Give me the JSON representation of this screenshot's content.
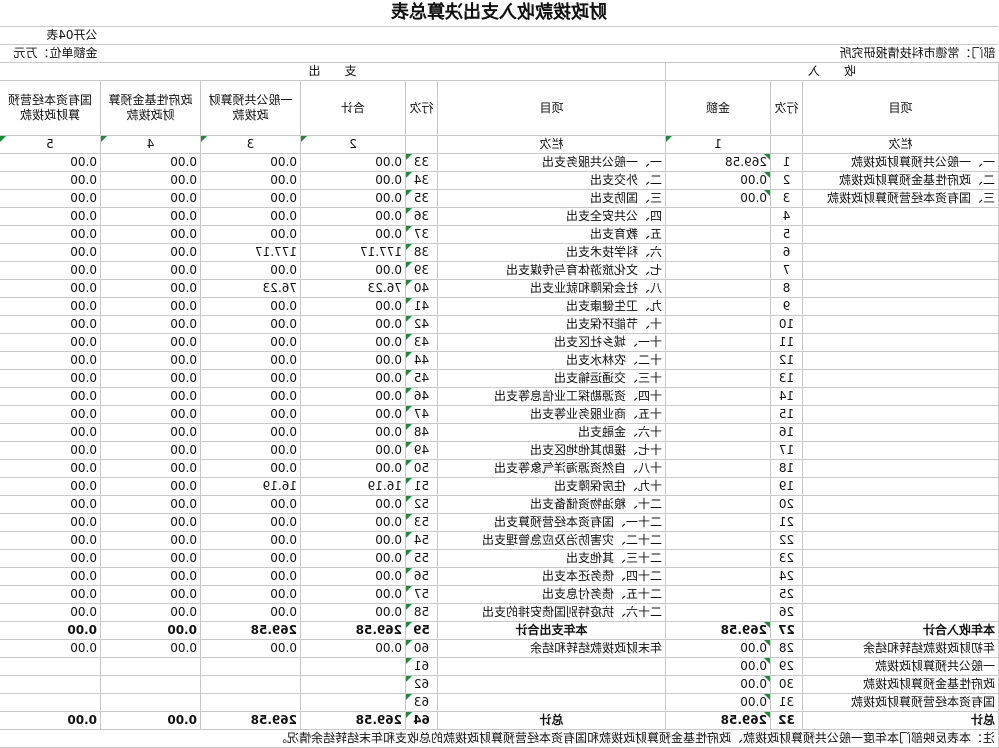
{
  "title": "财政拨款收入支出决算总表",
  "form_code": "公开04表",
  "unit": "金额单位：万元",
  "department": "部门：常德市科技情报研究所",
  "section_income": "收　　入",
  "section_expense": "支　　出",
  "headers": {
    "item": "项目",
    "line": "行次",
    "amount": "金额",
    "item2": "项目",
    "line2": "行次",
    "total": "合计",
    "general": "一般公共预算财政拨款",
    "fund": "政府性基金预算财政拨款",
    "state": "国有资本经营预算财政拨款"
  },
  "col_index": {
    "a": "栏次",
    "b": "1",
    "c": "栏次",
    "d": "2",
    "e": "3",
    "f": "4",
    "g": "5"
  },
  "rows": [
    {
      "income_item": "一、一般公共预算财政拨款",
      "line": "1",
      "amount": "269.58",
      "expense_item": "一、一般公共服务支出",
      "line2": "33",
      "total": "0.00",
      "general": "0.00",
      "fund": "0.00",
      "state": "0.00"
    },
    {
      "income_item": "二、政府性基金预算财政拨款",
      "line": "2",
      "amount": "0.00",
      "expense_item": "二、外交支出",
      "line2": "34",
      "total": "0.00",
      "general": "0.00",
      "fund": "0.00",
      "state": "0.00"
    },
    {
      "income_item": "三、国有资本经营预算财政拨款",
      "line": "3",
      "amount": "0.00",
      "expense_item": "三、国防支出",
      "line2": "35",
      "total": "0.00",
      "general": "0.00",
      "fund": "0.00",
      "state": "0.00"
    },
    {
      "income_item": "",
      "line": "4",
      "amount": "",
      "expense_item": "四、公共安全支出",
      "line2": "36",
      "total": "0.00",
      "general": "0.00",
      "fund": "0.00",
      "state": "0.00"
    },
    {
      "income_item": "",
      "line": "5",
      "amount": "",
      "expense_item": "五、教育支出",
      "line2": "37",
      "total": "0.00",
      "general": "0.00",
      "fund": "0.00",
      "state": "0.00"
    },
    {
      "income_item": "",
      "line": "6",
      "amount": "",
      "expense_item": "六、科学技术支出",
      "line2": "38",
      "total": "177.17",
      "general": "177.17",
      "fund": "0.00",
      "state": "0.00"
    },
    {
      "income_item": "",
      "line": "7",
      "amount": "",
      "expense_item": "七、文化旅游体育与传媒支出",
      "line2": "39",
      "total": "0.00",
      "general": "0.00",
      "fund": "0.00",
      "state": "0.00"
    },
    {
      "income_item": "",
      "line": "8",
      "amount": "",
      "expense_item": "八、社会保障和就业支出",
      "line2": "40",
      "total": "76.23",
      "general": "76.23",
      "fund": "0.00",
      "state": "0.00"
    },
    {
      "income_item": "",
      "line": "9",
      "amount": "",
      "expense_item": "九、卫生健康支出",
      "line2": "41",
      "total": "0.00",
      "general": "0.00",
      "fund": "0.00",
      "state": "0.00"
    },
    {
      "income_item": "",
      "line": "10",
      "amount": "",
      "expense_item": "十、节能环保支出",
      "line2": "42",
      "total": "0.00",
      "general": "0.00",
      "fund": "0.00",
      "state": "0.00"
    },
    {
      "income_item": "",
      "line": "11",
      "amount": "",
      "expense_item": "十一、城乡社区支出",
      "line2": "43",
      "total": "0.00",
      "general": "0.00",
      "fund": "0.00",
      "state": "0.00"
    },
    {
      "income_item": "",
      "line": "12",
      "amount": "",
      "expense_item": "十二、农林水支出",
      "line2": "44",
      "total": "0.00",
      "general": "0.00",
      "fund": "0.00",
      "state": "0.00"
    },
    {
      "income_item": "",
      "line": "13",
      "amount": "",
      "expense_item": "十三、交通运输支出",
      "line2": "45",
      "total": "0.00",
      "general": "0.00",
      "fund": "0.00",
      "state": "0.00"
    },
    {
      "income_item": "",
      "line": "14",
      "amount": "",
      "expense_item": "十四、资源勘探工业信息等支出",
      "line2": "46",
      "total": "0.00",
      "general": "0.00",
      "fund": "0.00",
      "state": "0.00"
    },
    {
      "income_item": "",
      "line": "15",
      "amount": "",
      "expense_item": "十五、商业服务业等支出",
      "line2": "47",
      "total": "0.00",
      "general": "0.00",
      "fund": "0.00",
      "state": "0.00"
    },
    {
      "income_item": "",
      "line": "16",
      "amount": "",
      "expense_item": "十六、金融支出",
      "line2": "48",
      "total": "0.00",
      "general": "0.00",
      "fund": "0.00",
      "state": "0.00"
    },
    {
      "income_item": "",
      "line": "17",
      "amount": "",
      "expense_item": "十七、援助其他地区支出",
      "line2": "49",
      "total": "0.00",
      "general": "0.00",
      "fund": "0.00",
      "state": "0.00"
    },
    {
      "income_item": "",
      "line": "18",
      "amount": "",
      "expense_item": "十八、自然资源海洋气象等支出",
      "line2": "50",
      "total": "0.00",
      "general": "0.00",
      "fund": "0.00",
      "state": "0.00"
    },
    {
      "income_item": "",
      "line": "19",
      "amount": "",
      "expense_item": "十九、住房保障支出",
      "line2": "51",
      "total": "16.19",
      "general": "16.19",
      "fund": "0.00",
      "state": "0.00"
    },
    {
      "income_item": "",
      "line": "20",
      "amount": "",
      "expense_item": "二十、粮油物资储备支出",
      "line2": "52",
      "total": "0.00",
      "general": "0.00",
      "fund": "0.00",
      "state": "0.00"
    },
    {
      "income_item": "",
      "line": "21",
      "amount": "",
      "expense_item": "二十一、国有资本经营预算支出",
      "line2": "53",
      "total": "0.00",
      "general": "0.00",
      "fund": "0.00",
      "state": "0.00"
    },
    {
      "income_item": "",
      "line": "22",
      "amount": "",
      "expense_item": "二十二、灾害防治及应急管理支出",
      "line2": "54",
      "total": "0.00",
      "general": "0.00",
      "fund": "0.00",
      "state": "0.00"
    },
    {
      "income_item": "",
      "line": "23",
      "amount": "",
      "expense_item": "二十三、其他支出",
      "line2": "55",
      "total": "0.00",
      "general": "0.00",
      "fund": "0.00",
      "state": "0.00"
    },
    {
      "income_item": "",
      "line": "24",
      "amount": "",
      "expense_item": "二十四、债务还本支出",
      "line2": "56",
      "total": "0.00",
      "general": "0.00",
      "fund": "0.00",
      "state": "0.00"
    },
    {
      "income_item": "",
      "line": "25",
      "amount": "",
      "expense_item": "二十五、债务付息支出",
      "line2": "57",
      "total": "0.00",
      "general": "0.00",
      "fund": "0.00",
      "state": "0.00"
    },
    {
      "income_item": "",
      "line": "26",
      "amount": "",
      "expense_item": "二十六、抗疫特别国债安排的支出",
      "line2": "58",
      "total": "0.00",
      "general": "0.00",
      "fund": "0.00",
      "state": "0.00"
    }
  ],
  "summary_rows": [
    {
      "income_item": "本年收入合计",
      "line": "27",
      "amount": "269.58",
      "expense_item": "本年支出合计",
      "line2": "59",
      "total": "269.58",
      "general": "269.58",
      "fund": "0.00",
      "state": "0.00",
      "bold": true
    },
    {
      "income_item": "年初财政拨款结转和结余",
      "line": "28",
      "amount": "0.00",
      "expense_item": "年末财政拨款结转和结余",
      "line2": "60",
      "total": "0.00",
      "general": "0.00",
      "fund": "0.00",
      "state": "0.00",
      "bold": false
    },
    {
      "income_item": "一般公共预算财政拨款",
      "line": "29",
      "amount": "0.00",
      "expense_item": "",
      "line2": "61",
      "total": "",
      "general": "",
      "fund": "",
      "state": "",
      "bold": false
    },
    {
      "income_item": "政府性基金预算财政拨款",
      "line": "30",
      "amount": "0.00",
      "expense_item": "",
      "line2": "62",
      "total": "",
      "general": "",
      "fund": "",
      "state": "",
      "bold": false
    },
    {
      "income_item": "国有资本经营预算财政拨款",
      "line": "31",
      "amount": "0.00",
      "expense_item": "",
      "line2": "63",
      "total": "",
      "general": "",
      "fund": "",
      "state": "",
      "bold": false
    },
    {
      "income_item": "总计",
      "line": "32",
      "amount": "269.58",
      "expense_item": "总计",
      "line2": "64",
      "total": "269.58",
      "general": "269.58",
      "fund": "0.00",
      "state": "0.00",
      "bold": true
    }
  ],
  "note": "注：本表反映部门本年度一般公共预算财政拨款、政府性基金预算财政拨款和国有资本经营预算财政拨款的总收支和年末结转结余情况。"
}
